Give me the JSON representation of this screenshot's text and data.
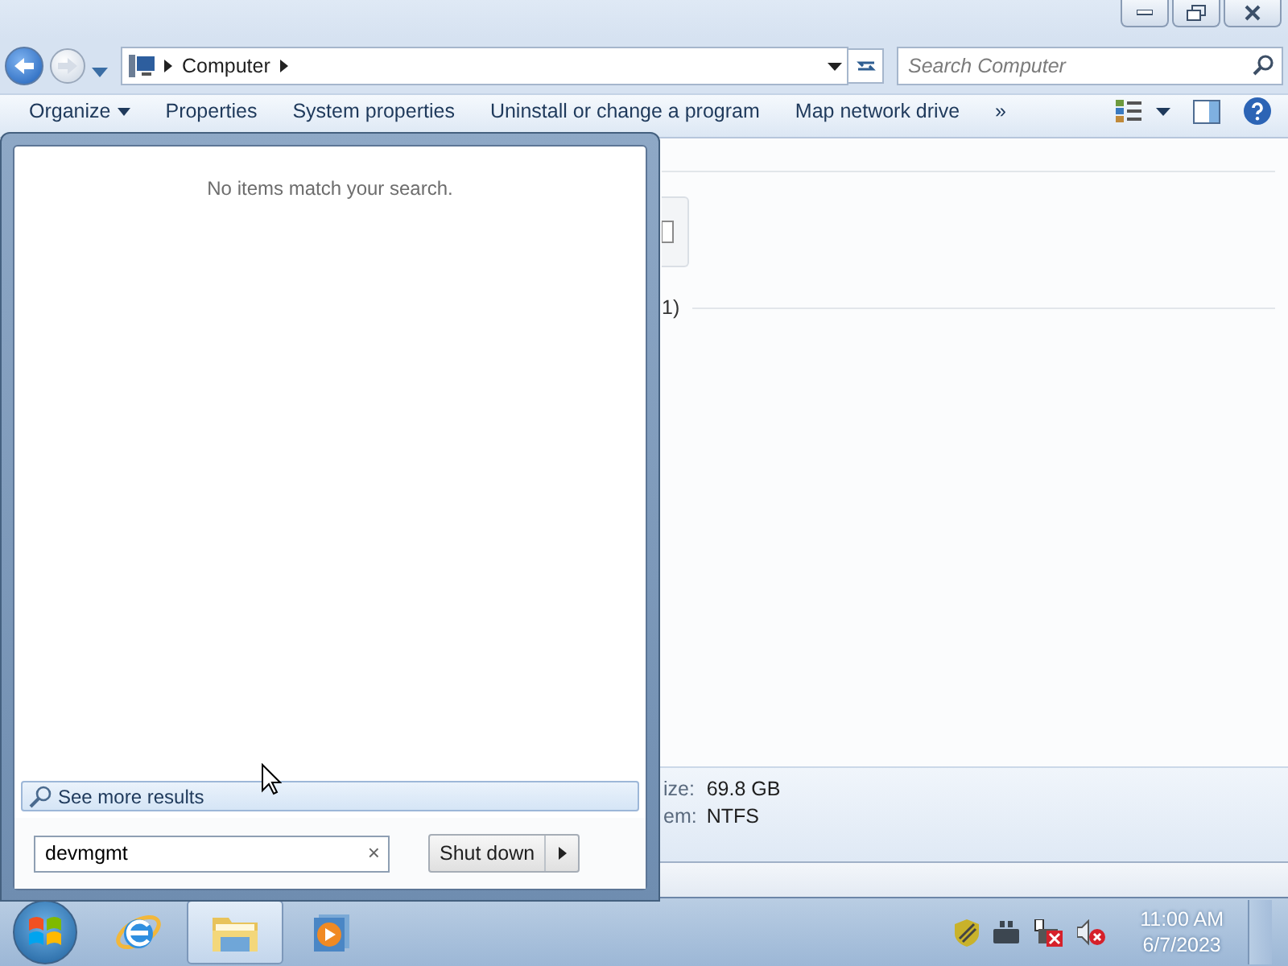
{
  "window": {
    "address": {
      "breadcrumb": [
        "Computer"
      ]
    },
    "search": {
      "placeholder": "Search Computer"
    },
    "toolbar": [
      {
        "label": "Organize",
        "kind": "menu"
      },
      {
        "label": "Properties",
        "kind": "command"
      },
      {
        "label": "System properties",
        "kind": "command"
      },
      {
        "label": "Uninstall or change a program",
        "kind": "command"
      },
      {
        "label": "Map network drive",
        "kind": "command"
      },
      {
        "label": "»",
        "kind": "overflow"
      }
    ],
    "content": {
      "group_header": "1)"
    },
    "details": [
      {
        "label": "ize:",
        "value": "69.8 GB"
      },
      {
        "label": "em:",
        "value": "NTFS"
      }
    ]
  },
  "start_menu": {
    "message": "No items match your search.",
    "more_results": "See more results",
    "search": {
      "value": "devmgmt",
      "clear": "×"
    },
    "shut_down": "Shut down"
  },
  "taskbar": {
    "pinned": [
      {
        "kind": "browser",
        "selected": false
      },
      {
        "kind": "explorer",
        "selected": true
      },
      {
        "kind": "media",
        "selected": false
      }
    ],
    "clock": {
      "time": "11:00 AM",
      "date": "6/7/2023"
    }
  }
}
